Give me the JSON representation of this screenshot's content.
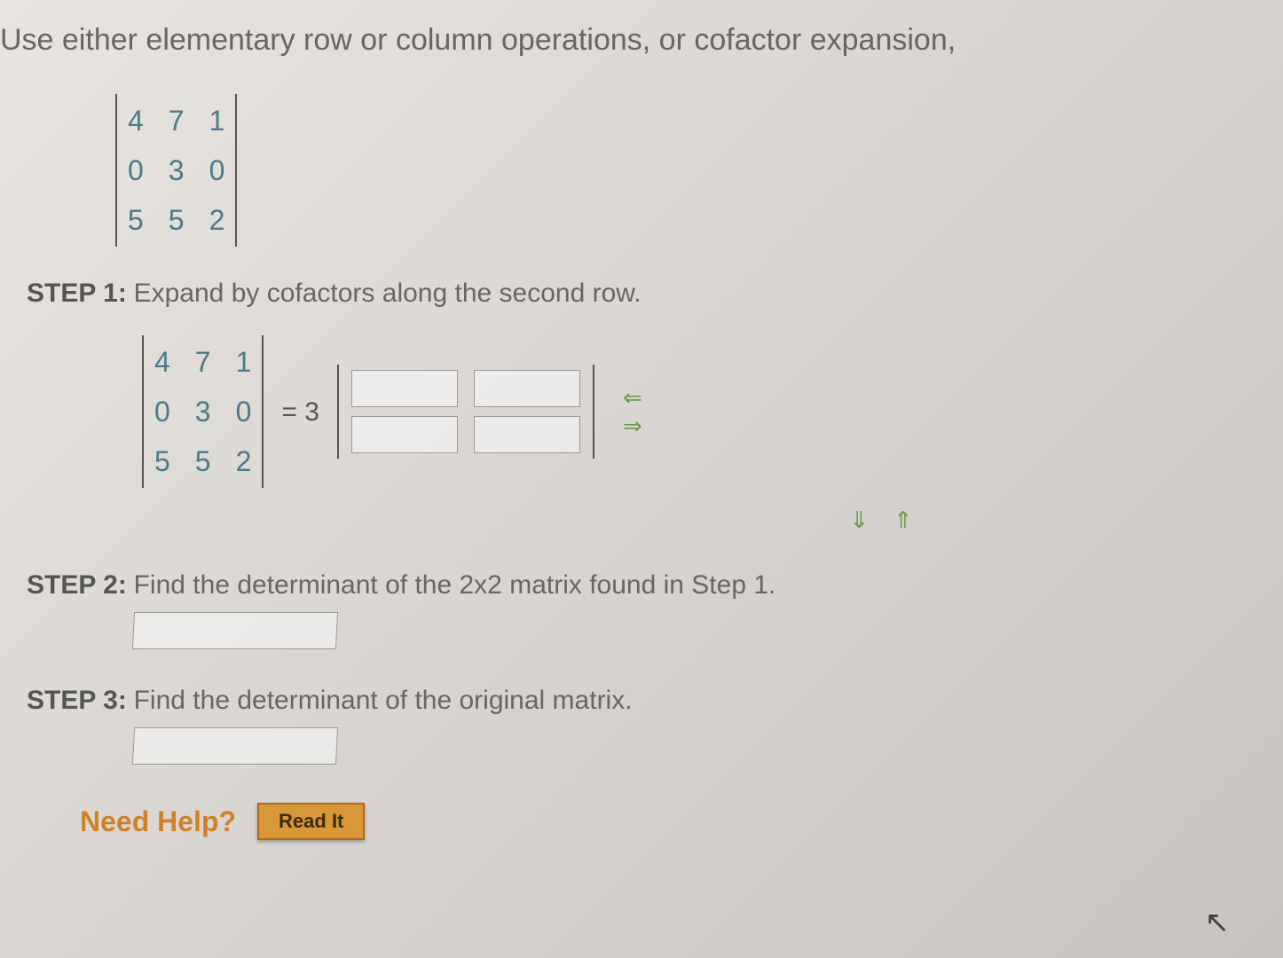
{
  "instruction": "Use either elementary row or column operations, or cofactor expansion,",
  "matrix": {
    "rows": [
      [
        "4",
        "7",
        "1"
      ],
      [
        "0",
        "3",
        "0"
      ],
      [
        "5",
        "5",
        "2"
      ]
    ]
  },
  "step1": {
    "label": "STEP 1:",
    "text": "Expand by cofactors along the second row.",
    "equals": "= 3"
  },
  "step2": {
    "label": "STEP 2:",
    "text": "Find the determinant of the 2x2 matrix found in Step 1."
  },
  "step3": {
    "label": "STEP 3:",
    "text": "Find the determinant of the original matrix."
  },
  "help": {
    "label": "Need Help?",
    "readit": "Read It"
  },
  "arrows": {
    "left": "⇐",
    "right": "⇒",
    "down": "⇓",
    "up": "⇑"
  }
}
